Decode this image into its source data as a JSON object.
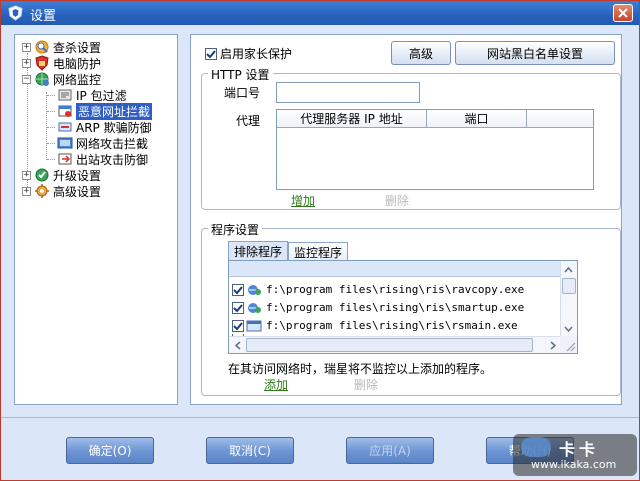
{
  "window": {
    "title": "设置",
    "close_label": "✕"
  },
  "tree": {
    "items": [
      {
        "label": "查杀设置",
        "expander": "+",
        "icon": "scan-icon"
      },
      {
        "label": "电脑防护",
        "expander": "+",
        "icon": "shield-icon"
      },
      {
        "label": "网络监控",
        "expander": "−",
        "icon": "network-icon"
      },
      {
        "label": "IP 包过滤",
        "icon": "ip-filter-icon"
      },
      {
        "label": "恶意网址拦截",
        "icon": "url-block-icon",
        "selected": true
      },
      {
        "label": "ARP 欺骗防御",
        "icon": "arp-icon"
      },
      {
        "label": "网络攻击拦截",
        "icon": "attack-block-icon"
      },
      {
        "label": "出站攻击防御",
        "icon": "outbound-icon"
      },
      {
        "label": "升级设置",
        "expander": "+",
        "icon": "update-icon"
      },
      {
        "label": "高级设置",
        "expander": "+",
        "icon": "advanced-icon"
      }
    ]
  },
  "main": {
    "parental_control": {
      "label": "启用家长保护",
      "checked": true
    },
    "advanced_button": "高级",
    "whitelist_button": "网站黑白名单设置",
    "http": {
      "legend": "HTTP 设置",
      "port_label": "端口号",
      "port_value": "",
      "proxy_label": "代理",
      "columns": [
        "代理服务器 IP 地址",
        "端口"
      ],
      "add_label": "增加",
      "delete_label": "删除"
    },
    "program": {
      "legend": "程序设置",
      "tabs": [
        "排除程序",
        "监控程序"
      ],
      "active_tab": 0,
      "rows": [
        {
          "path": "f:\\program files\\rising\\ris\\ravcopy.exe",
          "checked": true
        },
        {
          "path": "f:\\program files\\rising\\ris\\smartup.exe",
          "checked": true
        },
        {
          "path": "f:\\program files\\rising\\ris\\rsmain.exe",
          "checked": true
        }
      ],
      "note": "在其访问网络时，瑞星将不监控以上添加的程序。",
      "add_label": "添加",
      "delete_label": "删除"
    }
  },
  "footer": {
    "ok": "确定(O)",
    "cancel": "取消(C)",
    "apply": "应用(A)",
    "help": "帮助(H)"
  },
  "watermark": {
    "brand": "卡卡",
    "url": "www.ikaka.com"
  },
  "colors": {
    "titlebar": "#2862be",
    "selected": "#2f5fc4",
    "link": "#2d7a1c",
    "panel_bg": "#dbe6f8"
  }
}
